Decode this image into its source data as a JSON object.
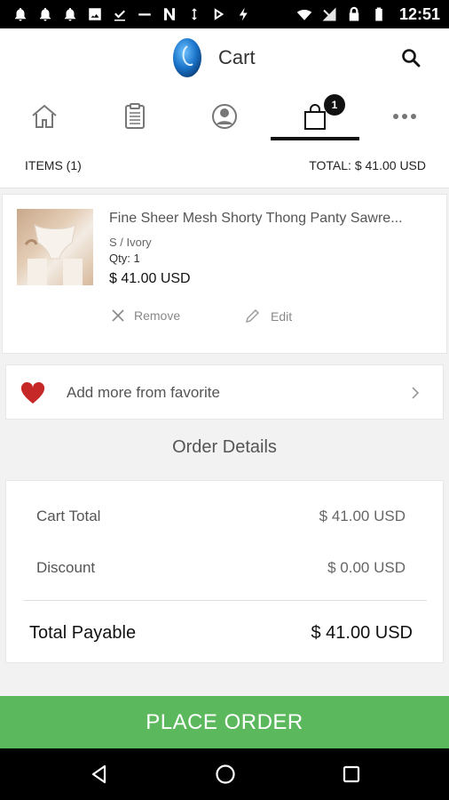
{
  "status_bar": {
    "time": "12:51",
    "left_icons": [
      "notification-bell-icon",
      "notification-bell-icon",
      "notification-bell-icon",
      "image-icon",
      "download-check-icon",
      "dash-icon",
      "n-icon",
      "sync-icon",
      "play-store-icon",
      "flash-icon"
    ],
    "right_icons": [
      "wifi-icon",
      "no-signal-icon",
      "lock-icon",
      "battery-icon"
    ]
  },
  "header": {
    "title": "Cart"
  },
  "tabs": [
    {
      "name": "home",
      "icon": "home-icon"
    },
    {
      "name": "orders",
      "icon": "clipboard-icon"
    },
    {
      "name": "account",
      "icon": "user-icon"
    },
    {
      "name": "cart",
      "icon": "shopping-bag-icon",
      "active": true,
      "badge": "1"
    },
    {
      "name": "more",
      "icon": "more-icon"
    }
  ],
  "summary": {
    "items_label": "ITEMS (1)",
    "total_label": "TOTAL: $ 41.00 USD"
  },
  "cart_item": {
    "name": "Fine Sheer Mesh Shorty Thong Panty Sawre...",
    "variant": "S / Ivory",
    "qty": "Qty: 1",
    "price": "$ 41.00 USD",
    "remove_label": "Remove",
    "edit_label": "Edit"
  },
  "favorites": {
    "label": "Add more from favorite"
  },
  "order_details": {
    "title": "Order Details",
    "cart_total_label": "Cart Total",
    "cart_total_value": "$ 41.00 USD",
    "discount_label": "Discount",
    "discount_value": "$ 0.00 USD",
    "total_label": "Total Payable",
    "total_value": "$ 41.00 USD"
  },
  "actions": {
    "place_order_label": "PLACE ORDER"
  },
  "colors": {
    "accent_green": "#5cb85c",
    "heart_red": "#c62828",
    "badge": "#111111"
  }
}
